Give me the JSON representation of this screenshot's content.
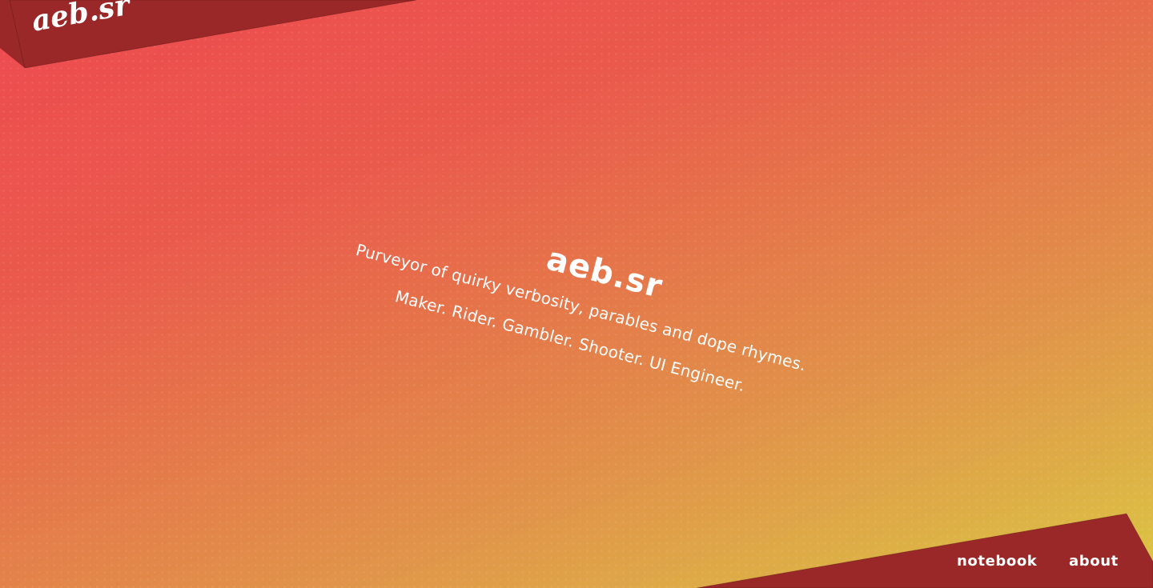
{
  "brand": {
    "logo_text": "aeb.sr",
    "banner_color": "#9b2828"
  },
  "hero": {
    "title": "aeb.sr",
    "tagline": "Purveyor of quirky verbosity, parables and dope rhymes.",
    "roles": "Maker. Rider. Gambler. Shooter. UI Engineer."
  },
  "nav": {
    "items": [
      {
        "label": "notebook"
      },
      {
        "label": "about"
      }
    ],
    "banner_color": "#9b2828"
  },
  "colors": {
    "gradient_start": "#ee4a50",
    "gradient_end": "#dcc843",
    "text": "#ffffff"
  }
}
